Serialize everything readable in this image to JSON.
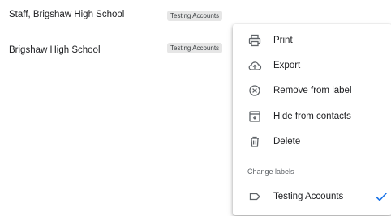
{
  "contacts": [
    {
      "name": "Staff, Brigshaw High School",
      "label": "Testing Accounts"
    },
    {
      "name": "Brigshaw High School",
      "label": "Testing Accounts"
    }
  ],
  "menu": {
    "items": [
      {
        "label": "Print",
        "icon": "printer-icon"
      },
      {
        "label": "Export",
        "icon": "cloud-upload-icon"
      },
      {
        "label": "Remove from label",
        "icon": "circle-x-icon"
      },
      {
        "label": "Hide from contacts",
        "icon": "archive-icon"
      },
      {
        "label": "Delete",
        "icon": "trash-icon"
      }
    ],
    "section_title": "Change labels",
    "labels": [
      {
        "label": "Testing Accounts",
        "icon": "label-tag-icon",
        "checked": true
      }
    ]
  },
  "colors": {
    "icon": "#5f6368",
    "check": "#1a73e8",
    "chip_bg": "#e6e6e6"
  }
}
